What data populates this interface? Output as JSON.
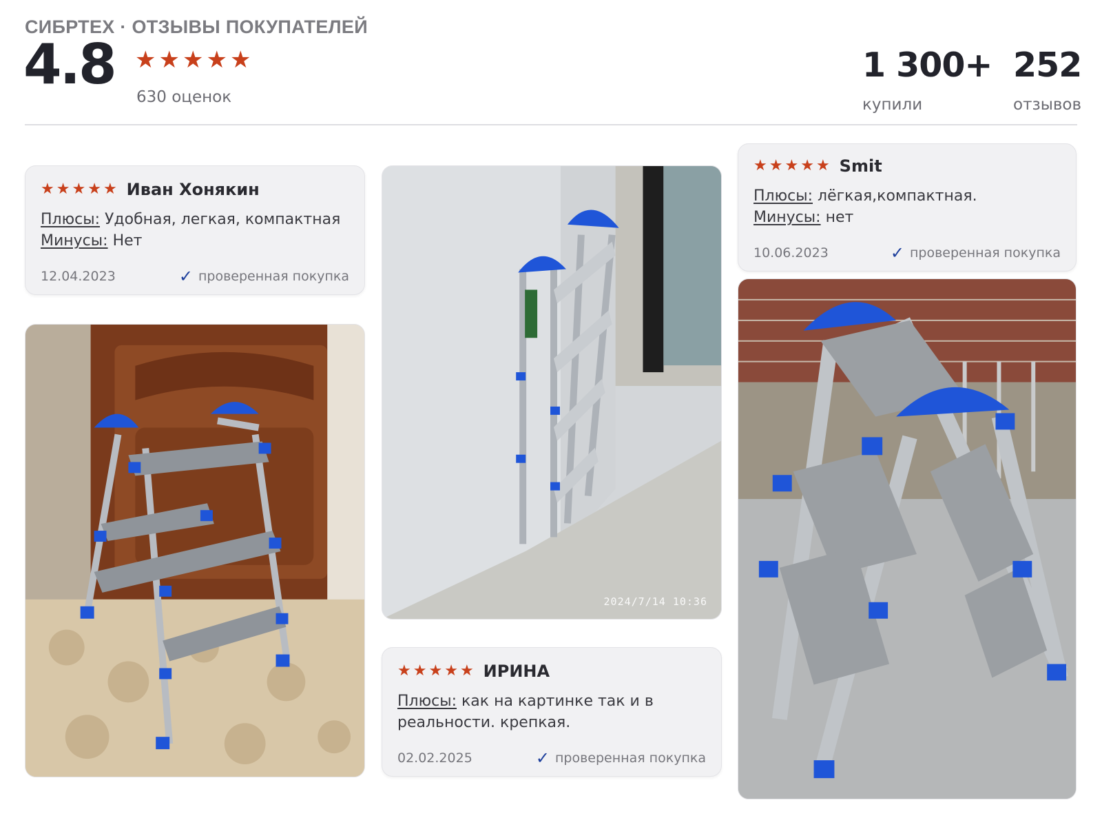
{
  "header": {
    "brand": "СИБРТЕХ · ОТЗЫВЫ ПОКУПАТЕЛЕЙ",
    "rating": "4.8",
    "rating_count": "630 оценок",
    "stars_icon": "star-icon",
    "star_color": "#c8401b",
    "stats": [
      {
        "value": "1 300+",
        "label": "купили"
      },
      {
        "value": "252",
        "label": "отзывов"
      }
    ]
  },
  "reviews": [
    {
      "author": "Иван Хонякин",
      "stars": 5,
      "pros_label": "Плюсы:",
      "pros": "Удобная, легкая, компактная",
      "cons_label": "Минусы:",
      "cons": "Нет",
      "date": "12.04.2023",
      "verified": "проверенная покупка"
    },
    {
      "author": "Smit",
      "stars": 5,
      "pros_label": "Плюсы:",
      "pros": "лёгкая,компактная.",
      "cons_label": "Минусы:",
      "cons": "нет",
      "date": "10.06.2023",
      "verified": "проверенная покупка"
    },
    {
      "author": "ИРИНА",
      "stars": 5,
      "pros_label": "Плюсы:",
      "pros": "как на картинке так и в реальности. крепкая.",
      "date": "02.02.2025",
      "verified": "проверенная покупка"
    }
  ],
  "photos": {
    "photo_2_timestamp": "2024/7/14 10:36"
  },
  "colors": {
    "check": "#1d3f9c",
    "card_bg": "#f1f1f3"
  }
}
